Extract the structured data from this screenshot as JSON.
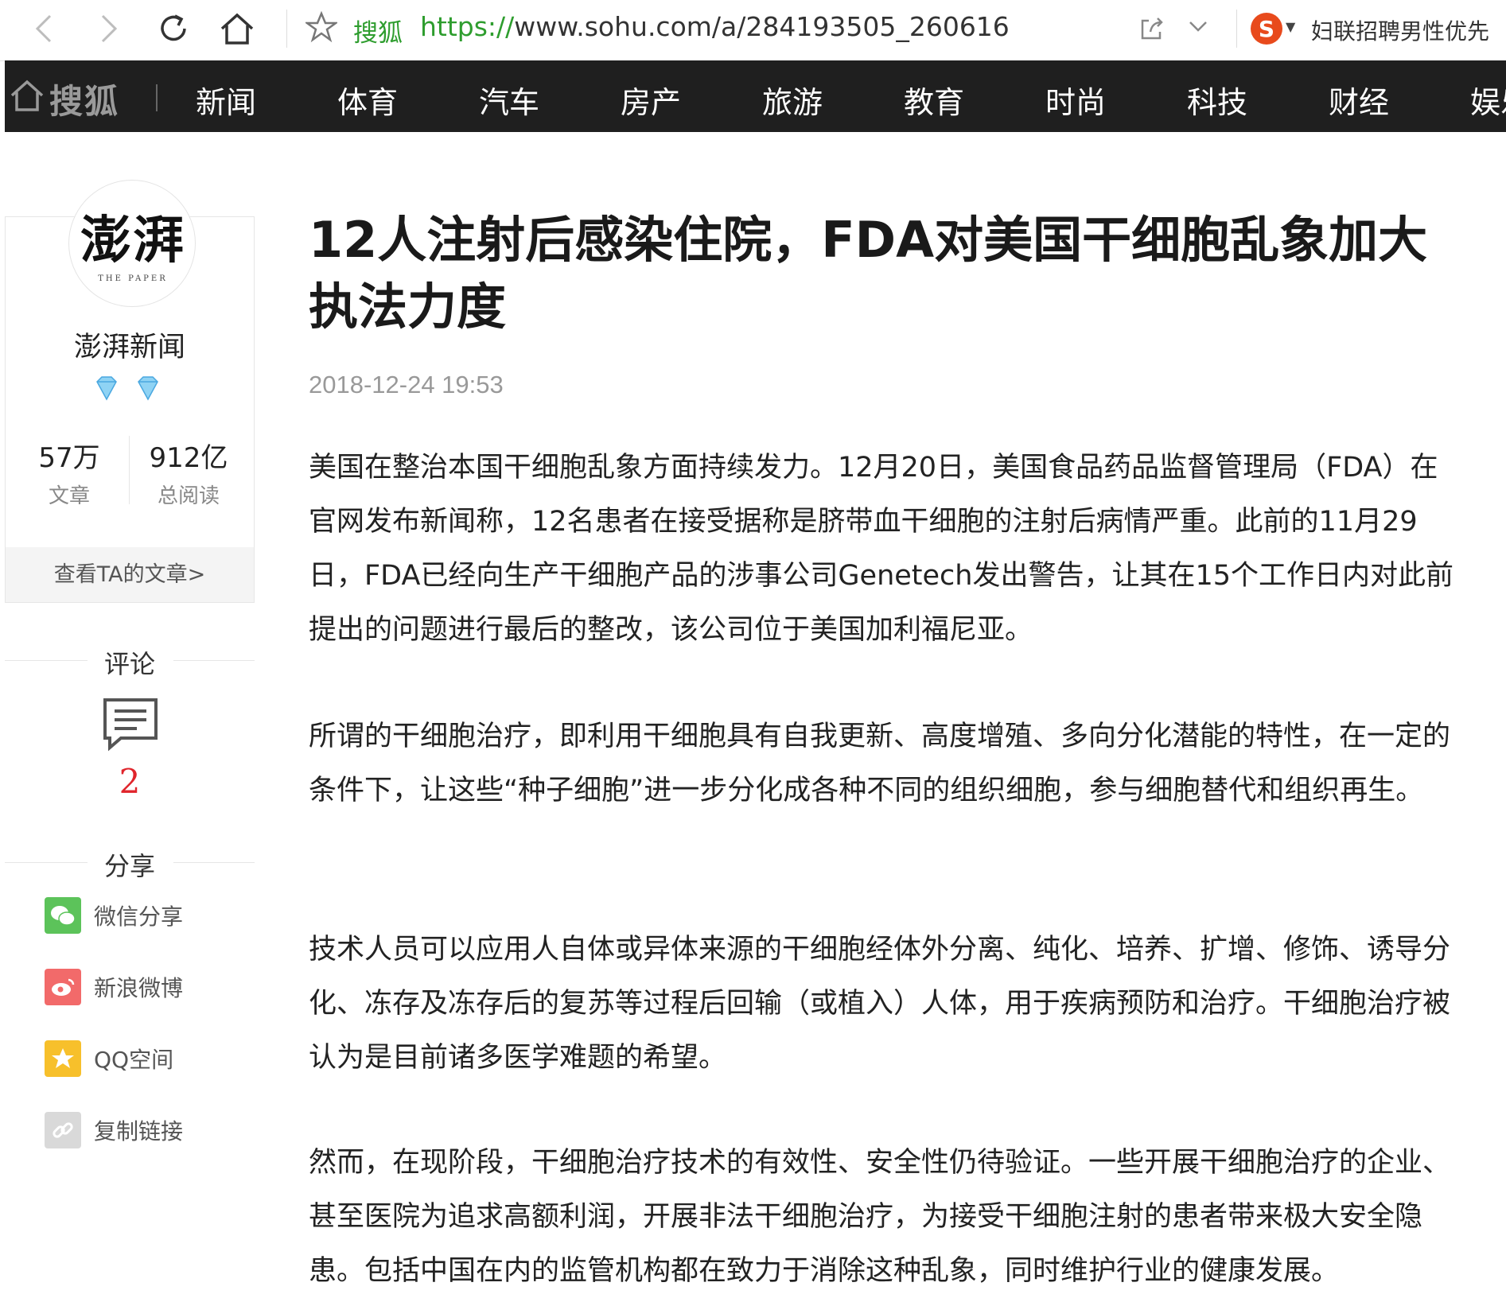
{
  "browser": {
    "site_label": "搜狐",
    "url_protocol": "https://",
    "url_rest": "www.sohu.com/a/284193505_260616",
    "search_engine_badge": "S",
    "search_promo": "妇联招聘男性优先",
    "icons": [
      "back-icon",
      "forward-icon",
      "reload-icon",
      "home-icon",
      "star-icon",
      "share-icon",
      "chevron-down-icon"
    ]
  },
  "nav": {
    "logo": "搜狐",
    "items": [
      {
        "label": "新闻"
      },
      {
        "label": "体育"
      },
      {
        "label": "汽车"
      },
      {
        "label": "房产"
      },
      {
        "label": "旅游"
      },
      {
        "label": "教育"
      },
      {
        "label": "时尚"
      },
      {
        "label": "科技"
      },
      {
        "label": "财经"
      },
      {
        "label": "娱乐"
      }
    ]
  },
  "author": {
    "avatar_calligraphy": "澎湃",
    "avatar_sub": "THE PAPER",
    "name": "澎湃新闻",
    "articles_count": "57万",
    "articles_label": "文章",
    "reads_count": "912亿",
    "reads_label": "总阅读",
    "view_articles": "查看TA的文章>"
  },
  "comments": {
    "title": "评论",
    "count": "2"
  },
  "share": {
    "title": "分享",
    "items": [
      {
        "label": "微信分享",
        "icon": "wechat-icon",
        "color": "#5cc35a"
      },
      {
        "label": "新浪微博",
        "icon": "weibo-icon",
        "color": "#f26a6a"
      },
      {
        "label": "QQ空间",
        "icon": "qzone-icon",
        "color": "#f7c02b"
      },
      {
        "label": "复制链接",
        "icon": "link-icon",
        "color": "#d9d9d9"
      }
    ]
  },
  "article": {
    "title": "12人注射后感染住院，FDA对美国干细胞乱象加大执法力度",
    "date": "2018-12-24 19:53",
    "paragraphs": [
      "美国在整治本国干细胞乱象方面持续发力。12月20日，美国食品药品监督管理局（FDA）在官网发布新闻称，12名患者在接受据称是脐带血干细胞的注射后病情严重。此前的11月29日，FDA已经向生产干细胞产品的涉事公司Genetech发出警告，让其在15个工作日内对此前提出的问题进行最后的整改，该公司位于美国加利福尼亚。",
      "所谓的干细胞治疗，即利用干细胞具有自我更新、高度增殖、多向分化潜能的特性，在一定的条件下，让这些“种子细胞”进一步分化成各种不同的组织细胞，参与细胞替代和组织再生。",
      "技术人员可以应用人自体或异体来源的干细胞经体外分离、纯化、培养、扩增、修饰、诱导分化、冻存及冻存后的复苏等过程后回输（或植入）人体，用于疾病预防和治疗。干细胞治疗被认为是目前诸多医学难题的希望。",
      "然而，在现阶段，干细胞治疗技术的有效性、安全性仍待验证。一些开展干细胞治疗的企业、甚至医院为追求高额利润，开展非法干细胞治疗，为接受干细胞注射的患者带来极大安全隐患。包括中国在内的监管机构都在致力于消除这种乱象，同时维护行业的健康发展。"
    ]
  },
  "colors": {
    "nav_bg": "#1f1f1f",
    "url_green": "#2e9d2e",
    "comment_count_red": "#e0242b"
  }
}
